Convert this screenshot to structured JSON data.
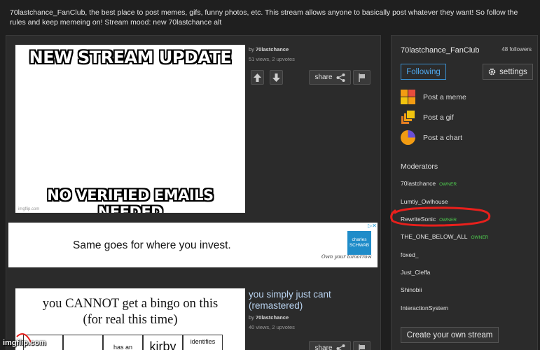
{
  "stream_description": "70lastchance_FanClub, the best place to post memes, gifs, funny photos, etc. This stream allows anyone to basically post whatever they want! So follow the rules and keep memeing on! Stream mood: new 70lastchance alt",
  "posts": [
    {
      "title": "",
      "meme_top": "NEW STREAM UPDATE",
      "meme_bottom": "NO VERIFIED EMAILS NEEDED",
      "img_credit": "imgflip.com",
      "by_prefix": "by",
      "author": "70lastchance",
      "stats": "51 views, 2 upvotes",
      "share_label": "share"
    },
    {
      "title": "you simply just cant (remastered)",
      "bingo_line1": "you CANNOT get a bingo on this",
      "bingo_line2": "(for real this time)",
      "bingo_cells": [
        "",
        "",
        "has an",
        "kirby",
        "identifies"
      ],
      "by_prefix": "by",
      "author": "70lastchance",
      "stats": "40 views, 2 upvotes",
      "share_label": "share"
    }
  ],
  "ad": {
    "text": "Same goes for where you invest.",
    "logo_line1": "charles",
    "logo_line2": "SCHWAB",
    "tagline": "Own your tomorrow"
  },
  "sidebar": {
    "stream_name": "70lastchance_FanClub",
    "followers": "48 followers",
    "following_label": "Following",
    "settings_label": "settings",
    "actions": [
      {
        "label": "Post a meme",
        "icon": "meme-icon"
      },
      {
        "label": "Post a gif",
        "icon": "gif-icon"
      },
      {
        "label": "Post a chart",
        "icon": "chart-icon"
      }
    ],
    "moderators_heading": "Moderators",
    "moderators": [
      {
        "name": "70lastchance",
        "role": "OWNER"
      },
      {
        "name": "Lumtiy_Owlhouse",
        "role": ""
      },
      {
        "name": "RewriteSonic",
        "role": "OWNER"
      },
      {
        "name": "THE_ONE_BELOW_ALL",
        "role": "OWNER"
      },
      {
        "name": "foxed_",
        "role": ""
      },
      {
        "name": "Just_Cleffa",
        "role": ""
      },
      {
        "name": "Shinobii",
        "role": ""
      },
      {
        "name": "InteractionSystem",
        "role": ""
      }
    ],
    "create_label": "Create your own stream"
  },
  "watermark": "imgflip.com",
  "colors": {
    "background": "#1f1f1f",
    "panel": "#2b2b2b",
    "accent": "#4fa8ee",
    "owner": "#4fcf4f",
    "annotation": "#e8201c"
  }
}
